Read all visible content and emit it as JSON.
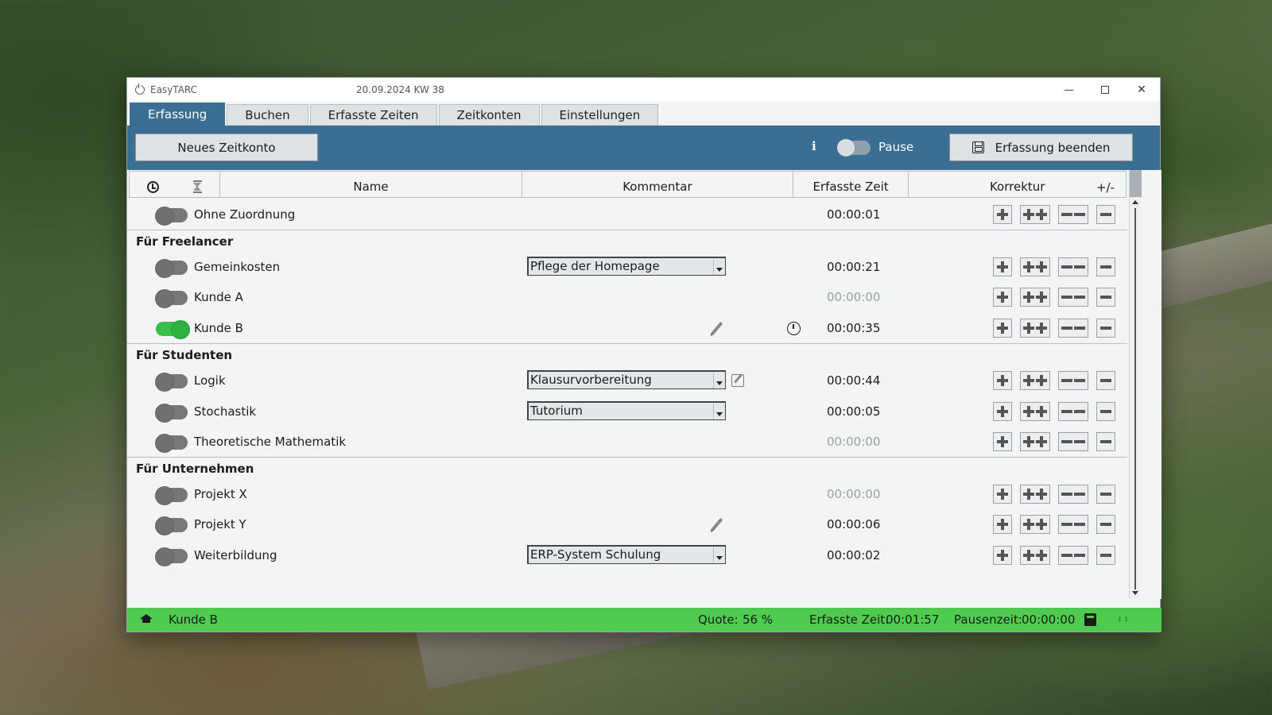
{
  "window": {
    "title": "EasyTARC",
    "date": "20.09.2024  KW 38"
  },
  "tabs": [
    {
      "label": "Erfassung",
      "active": true
    },
    {
      "label": "Buchen",
      "active": false
    },
    {
      "label": "Erfasste Zeiten",
      "active": false
    },
    {
      "label": "Zeitkonten",
      "active": false
    },
    {
      "label": "Einstellungen",
      "active": false
    }
  ],
  "toolbar": {
    "new_account_label": "Neues Zeitkonto",
    "info_label": "i",
    "pause_label": "Pause",
    "end_label": "Erfassung beenden"
  },
  "table": {
    "headers": {
      "name": "Name",
      "kommentar": "Kommentar",
      "erfasste_zeit": "Erfasste Zeit",
      "korrektur": "Korrektur",
      "plusminus": "+/-"
    }
  },
  "rows": {
    "ohne": {
      "name": "Ohne Zuordnung",
      "time": "00:00:01"
    },
    "group_freelancer": "Für Freelancer",
    "gemeinkosten": {
      "name": "Gemeinkosten",
      "comment": "Pflege der Homepage",
      "time": "00:00:21"
    },
    "kunde_a": {
      "name": "Kunde A",
      "time": "00:00:00"
    },
    "kunde_b": {
      "name": "Kunde B",
      "time": "00:00:35",
      "active": true
    },
    "group_studenten": "Für Studenten",
    "logik": {
      "name": "Logik",
      "comment": "Klausurvorbereitung",
      "time": "00:00:44"
    },
    "stochastik": {
      "name": "Stochastik",
      "comment": "Tutorium",
      "time": "00:00:05"
    },
    "theo": {
      "name": "Theoretische Mathematik",
      "time": "00:00:00"
    },
    "group_unternehmen": "Für Unternehmen",
    "projekt_x": {
      "name": "Projekt X",
      "time": "00:00:00"
    },
    "projekt_y": {
      "name": "Projekt Y",
      "time": "00:00:06"
    },
    "weiterbildung": {
      "name": "Weiterbildung",
      "comment": "ERP-System Schulung",
      "time": "00:00:02"
    }
  },
  "status": {
    "active_account": "Kunde B",
    "quote_label": "Quote:",
    "quote_value": "56 %",
    "erfasst_label": "Erfasste Zeit:",
    "erfasst_value": "00:01:57",
    "pause_label": "Pausenzeit:",
    "pause_value": "00:00:00"
  },
  "colors": {
    "accent": "#3a6e93",
    "status_bar": "#4fcb4f",
    "toggle_on": "#3bbf4a"
  }
}
